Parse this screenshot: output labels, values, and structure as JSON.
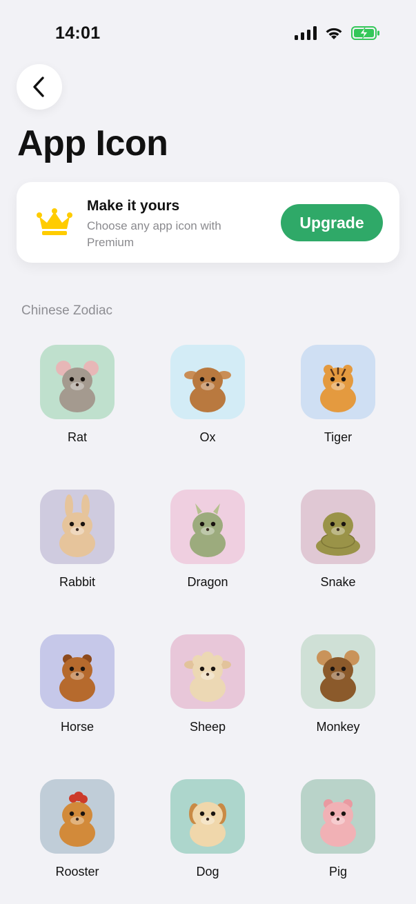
{
  "status_bar": {
    "time": "14:01",
    "icons": [
      "cellular-signal-icon",
      "wifi-icon",
      "battery-charging-icon"
    ]
  },
  "nav": {
    "back_icon": "chevron-left-icon"
  },
  "page": {
    "title": "App Icon"
  },
  "promo": {
    "icon": "crown-icon",
    "title": "Make it yours",
    "subtitle": "Choose any app icon with Premium",
    "button_label": "Upgrade",
    "colors": {
      "button": "#2fa968",
      "crown": "#ffcc00"
    }
  },
  "section": {
    "title": "Chinese Zodiac"
  },
  "icons": [
    {
      "label": "Rat",
      "bg": "#bfe0cd",
      "animal": "rat-icon"
    },
    {
      "label": "Ox",
      "bg": "#d3ecf6",
      "animal": "ox-icon"
    },
    {
      "label": "Tiger",
      "bg": "#cfdff3",
      "animal": "tiger-icon"
    },
    {
      "label": "Rabbit",
      "bg": "#cfcbdf",
      "animal": "rabbit-icon"
    },
    {
      "label": "Dragon",
      "bg": "#efcfe0",
      "animal": "dragon-icon"
    },
    {
      "label": "Snake",
      "bg": "#e0c8d4",
      "animal": "snake-icon"
    },
    {
      "label": "Horse",
      "bg": "#c6c8e9",
      "animal": "horse-icon"
    },
    {
      "label": "Sheep",
      "bg": "#e8c7d9",
      "animal": "sheep-icon"
    },
    {
      "label": "Monkey",
      "bg": "#cfe0d6",
      "animal": "monkey-icon"
    },
    {
      "label": "Rooster",
      "bg": "#c0cdd8",
      "animal": "rooster-icon"
    },
    {
      "label": "Dog",
      "bg": "#add6cc",
      "animal": "dog-icon"
    },
    {
      "label": "Pig",
      "bg": "#b9d3c9",
      "animal": "pig-icon"
    }
  ]
}
